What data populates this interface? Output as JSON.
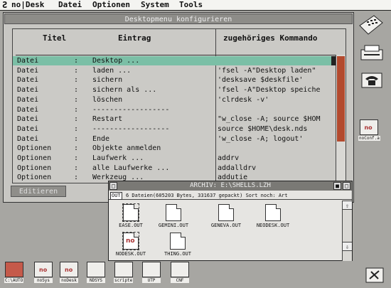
{
  "menu": {
    "logo": "Ƨ",
    "items": [
      "no|Desk",
      "Datei",
      "Optionen",
      "System",
      "Tools"
    ]
  },
  "dialog": {
    "title": "Desktopmenu konfigurieren",
    "headers": {
      "titel": "Titel",
      "eintrag": "Eintrag",
      "kommando": "zugehöriges Kommando"
    },
    "edit_button": "Editieren",
    "rows": [
      {
        "titel": "Datei",
        "sep": ":",
        "eintrag": "Desktop ...",
        "kommando": ""
      },
      {
        "titel": "Datei",
        "sep": ":",
        "eintrag": "laden ...",
        "kommando": "'fsel -A\"Desktop laden\""
      },
      {
        "titel": "Datei",
        "sep": ":",
        "eintrag": "sichern",
        "kommando": "'desksave $deskfile'"
      },
      {
        "titel": "Datei",
        "sep": ":",
        "eintrag": "sichern als ...",
        "kommando": "'fsel -A\"Desktop speiche"
      },
      {
        "titel": "Datei",
        "sep": ":",
        "eintrag": "löschen",
        "kommando": "'clrdesk -v'"
      },
      {
        "titel": "Datei",
        "sep": ":",
        "eintrag": "------------------",
        "kommando": ""
      },
      {
        "titel": "Datei",
        "sep": ":",
        "eintrag": "Restart",
        "kommando": "\"w_close -A; source $HOM"
      },
      {
        "titel": "Datei",
        "sep": ":",
        "eintrag": "------------------",
        "kommando": "source $HOME\\desk.nds"
      },
      {
        "titel": "Datei",
        "sep": ":",
        "eintrag": "Ende",
        "kommando": "'w_close -A; logout'"
      },
      {
        "titel": "Optionen",
        "sep": ":",
        "eintrag": "Objekte anmelden",
        "kommando": ""
      },
      {
        "titel": "Optionen",
        "sep": ":",
        "eintrag": "Laufwerk ...",
        "kommando": "addrv"
      },
      {
        "titel": "Optionen",
        "sep": ":",
        "eintrag": "alle Laufwerke ...",
        "kommando": "addalldrv"
      },
      {
        "titel": "Optionen",
        "sep": ":",
        "eintrag": "Werkzeug ...",
        "kommando": "addutie"
      }
    ]
  },
  "archive": {
    "title": "ARCHIV: E:\\SHELLS.LZH",
    "tag": "OUT",
    "info": "6 Dateien(605203 Bytes, 331637 gepackt)  Sort noch: Art",
    "files": [
      "EASE.OUT",
      "GEMINI.OUT",
      "GENEVA.OUT",
      "NEODESK.OUT",
      "NODESK.OUT",
      "THING.OUT"
    ]
  },
  "desktop_right": [
    {
      "label": ""
    },
    {
      "label": ""
    },
    {
      "label": ""
    },
    {
      "label": "noConf.a"
    }
  ],
  "taskbar": [
    {
      "label": "C:\\AUTO"
    },
    {
      "label": "noSys"
    },
    {
      "label": "noDesk"
    },
    {
      "label": "NDSYS"
    },
    {
      "label": "scripte"
    },
    {
      "label": "UTP"
    },
    {
      "label": "CNF"
    }
  ],
  "colors": {
    "selection": "#7bbfa6",
    "scroll_thumb": "#b34a2e",
    "desktop": "#a7a6a2"
  }
}
